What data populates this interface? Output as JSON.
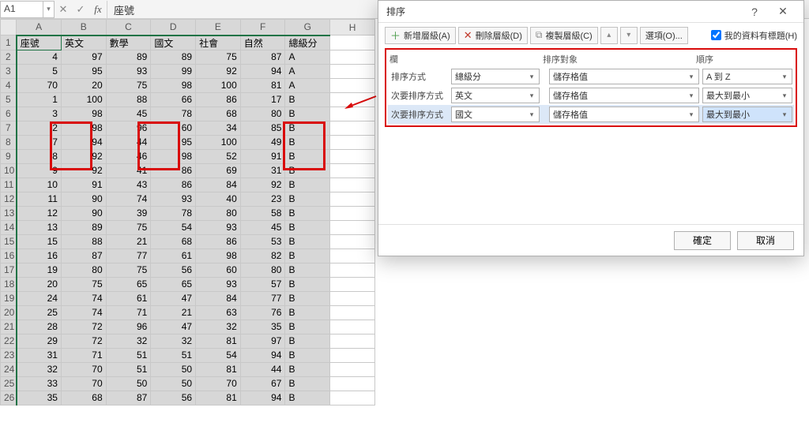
{
  "formula_bar": {
    "name_box": "A1",
    "fx_label": "fx",
    "value": "座號"
  },
  "sheet": {
    "columns": [
      "A",
      "B",
      "C",
      "D",
      "E",
      "F",
      "G",
      "H"
    ],
    "headers": [
      "座號",
      "英文",
      "數學",
      "國文",
      "社會",
      "自然",
      "總級分"
    ],
    "rows": [
      [
        4,
        97,
        89,
        89,
        75,
        87,
        "A"
      ],
      [
        5,
        95,
        93,
        99,
        92,
        94,
        "A"
      ],
      [
        70,
        20,
        75,
        98,
        100,
        81,
        "A"
      ],
      [
        1,
        100,
        88,
        66,
        86,
        17,
        "B"
      ],
      [
        3,
        98,
        45,
        78,
        68,
        80,
        "B"
      ],
      [
        2,
        98,
        96,
        60,
        34,
        85,
        "B"
      ],
      [
        7,
        94,
        44,
        95,
        100,
        49,
        "B"
      ],
      [
        8,
        92,
        46,
        98,
        52,
        91,
        "B"
      ],
      [
        9,
        92,
        41,
        86,
        69,
        31,
        "B"
      ],
      [
        10,
        91,
        43,
        86,
        84,
        92,
        "B"
      ],
      [
        11,
        90,
        74,
        93,
        40,
        23,
        "B"
      ],
      [
        12,
        90,
        39,
        78,
        80,
        58,
        "B"
      ],
      [
        13,
        89,
        75,
        54,
        93,
        45,
        "B"
      ],
      [
        15,
        88,
        21,
        68,
        86,
        53,
        "B"
      ],
      [
        16,
        87,
        77,
        61,
        98,
        82,
        "B"
      ],
      [
        19,
        80,
        75,
        56,
        60,
        80,
        "B"
      ],
      [
        20,
        75,
        65,
        65,
        93,
        57,
        "B"
      ],
      [
        24,
        74,
        61,
        47,
        84,
        77,
        "B"
      ],
      [
        25,
        74,
        71,
        21,
        63,
        76,
        "B"
      ],
      [
        28,
        72,
        96,
        47,
        32,
        35,
        "B"
      ],
      [
        29,
        72,
        32,
        32,
        81,
        97,
        "B"
      ],
      [
        31,
        71,
        51,
        51,
        54,
        94,
        "B"
      ],
      [
        32,
        70,
        51,
        50,
        81,
        44,
        "B"
      ],
      [
        33,
        70,
        50,
        50,
        70,
        67,
        "B"
      ],
      [
        35,
        68,
        87,
        56,
        81,
        94,
        "B"
      ]
    ]
  },
  "dialog": {
    "title": "排序",
    "toolbar": {
      "add": "新增層級(A)",
      "del": "刪除層級(D)",
      "copy": "複製層級(C)",
      "options": "選項(O)...",
      "header_checkbox": "我的資料有標題(H)"
    },
    "headers": {
      "col": "欄",
      "sorton": "排序對象",
      "order": "順序"
    },
    "values": {
      "sorton_value": "儲存格值",
      "a_to_z": "A 到 Z",
      "largest_first": "最大到最小"
    },
    "rows": [
      {
        "label": "排序方式",
        "col": "總級分",
        "order_key": "a_to_z"
      },
      {
        "label": "次要排序方式",
        "col": "英文",
        "order_key": "largest_first"
      },
      {
        "label": "次要排序方式",
        "col": "國文",
        "order_key": "largest_first"
      }
    ],
    "footer": {
      "ok": "確定",
      "cancel": "取消"
    }
  }
}
